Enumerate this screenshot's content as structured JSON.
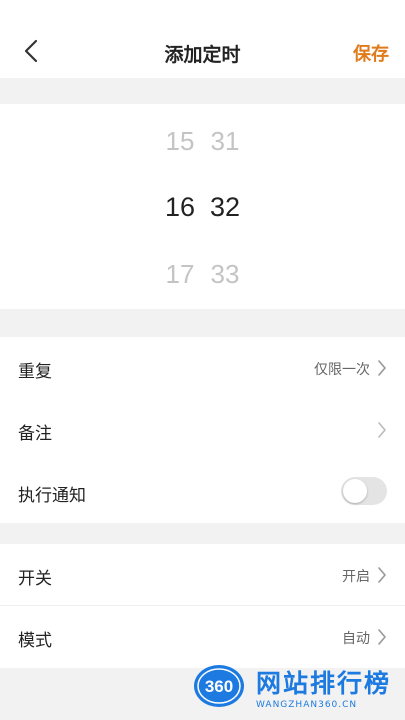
{
  "header": {
    "title": "添加定时",
    "save_label": "保存"
  },
  "picker": {
    "hours": {
      "prev": "15",
      "current": "16",
      "next": "17"
    },
    "minutes": {
      "prev": "31",
      "current": "32",
      "next": "33"
    }
  },
  "settings": {
    "repeat": {
      "label": "重复",
      "value": "仅限一次"
    },
    "note": {
      "label": "备注"
    },
    "notify": {
      "label": "执行通知",
      "enabled": false
    }
  },
  "control": {
    "switch": {
      "label": "开关",
      "value": "开启"
    },
    "mode": {
      "label": "模式",
      "value": "自动"
    }
  },
  "watermark": {
    "badge": "360",
    "title": "网站排行榜",
    "subtitle": "WANGZHAN360.CN"
  },
  "colors": {
    "accent": "#e07a1a",
    "background": "#f2f2f2",
    "watermark_blue": "#1c7ae0",
    "toggle_off": "#e4e4e4"
  },
  "icons": {
    "back": "chevron-left-icon",
    "chevron": "chevron-right-icon"
  }
}
